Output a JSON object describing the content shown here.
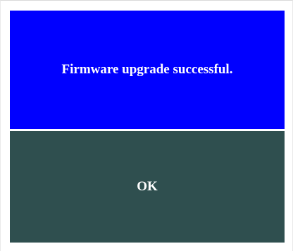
{
  "dialog": {
    "message": "Firmware upgrade successful.",
    "ok_label": "OK"
  },
  "colors": {
    "message_background": "#0000ff",
    "button_background": "#2f4f4f",
    "text": "#ffffff"
  }
}
